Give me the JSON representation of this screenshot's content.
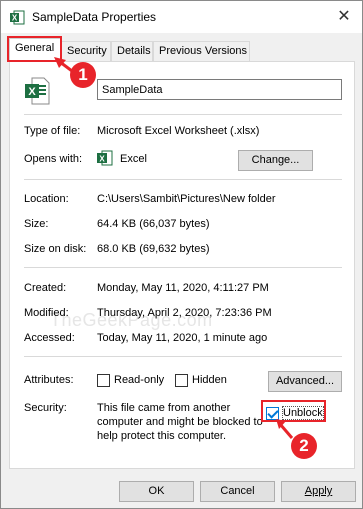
{
  "window": {
    "title": "SampleData Properties",
    "close_symbol": "✕"
  },
  "tabs": [
    {
      "label": "General",
      "active": true
    },
    {
      "label": "Security"
    },
    {
      "label": "Details"
    },
    {
      "label": "Previous Versions"
    }
  ],
  "general": {
    "file_name": "SampleData",
    "type_label": "Type of file:",
    "type_value": "Microsoft Excel Worksheet (.xlsx)",
    "opens_label": "Opens with:",
    "opens_value": "Excel",
    "change_button": "Change...",
    "location_label": "Location:",
    "location_value": "C:\\Users\\Sambit\\Pictures\\New folder",
    "size_label": "Size:",
    "size_value": "64.4 KB (66,037 bytes)",
    "size_on_disk_label": "Size on disk:",
    "size_on_disk_value": "68.0 KB (69,632 bytes)",
    "created_label": "Created:",
    "created_value": "Monday, May 11, 2020, 4:11:27 PM",
    "modified_label": "Modified:",
    "modified_value": "Thursday, April 2, 2020, 7:23:36 PM",
    "accessed_label": "Accessed:",
    "accessed_value": "Today, May 11, 2020, 1 minute ago",
    "attributes_label": "Attributes:",
    "readonly_label": "Read-only",
    "readonly_checked": false,
    "hidden_label": "Hidden",
    "hidden_checked": false,
    "advanced_button": "Advanced...",
    "security_label": "Security:",
    "security_text_1": "This file came from another",
    "security_text_2": "computer and might be blocked to",
    "security_text_3": "help protect this computer.",
    "unblock_label": "Unblock",
    "unblock_checked": true
  },
  "footer": {
    "ok": "OK",
    "cancel": "Cancel",
    "apply": "Apply"
  },
  "annotations": {
    "badge_1": "1",
    "badge_2": "2",
    "watermark": "TheGeekPage.com"
  },
  "colors": {
    "annotation_red": "#e8242a",
    "excel_green": "#1d6f42",
    "checkbox_blue": "#0078d7"
  }
}
